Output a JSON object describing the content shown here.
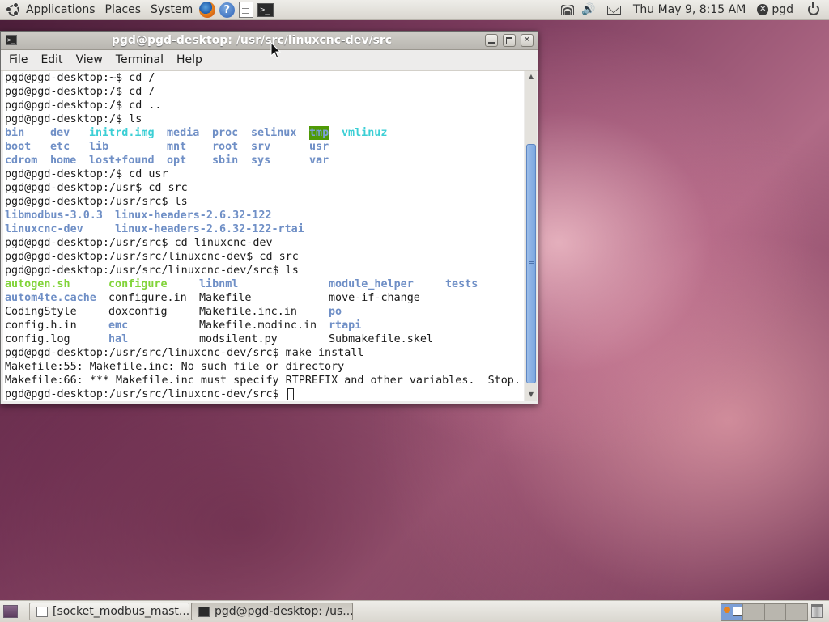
{
  "top_panel": {
    "menus": [
      "Applications",
      "Places",
      "System"
    ],
    "clock": "Thu May  9,  8:15 AM",
    "user": "pgd"
  },
  "terminal_window": {
    "title": "pgd@pgd-desktop: /usr/src/linuxcnc-dev/src",
    "menu": [
      "File",
      "Edit",
      "View",
      "Terminal",
      "Help"
    ],
    "lines": [
      "pgd@pgd-desktop:~$ cd /",
      "pgd@pgd-desktop:/$ cd /",
      "pgd@pgd-desktop:/$ cd ..",
      "pgd@pgd-desktop:/$ ls",
      "pgd@pgd-desktop:/$ cd usr",
      "pgd@pgd-desktop:/usr$ cd src",
      "pgd@pgd-desktop:/usr/src$ ls",
      "pgd@pgd-desktop:/usr/src$ cd linuxcnc-dev",
      "pgd@pgd-desktop:/usr/src/linuxcnc-dev$ cd src",
      "pgd@pgd-desktop:/usr/src/linuxcnc-dev/src$ ls",
      "pgd@pgd-desktop:/usr/src/linuxcnc-dev/src$ make install",
      "Makefile:55: Makefile.inc: No such file or directory",
      "Makefile:66: *** Makefile.inc must specify RTPREFIX and other variables.  Stop.",
      "pgd@pgd-desktop:/usr/src/linuxcnc-dev/src$ "
    ],
    "ls_root": [
      {
        "text": "bin",
        "type": "dir"
      },
      {
        "text": "dev",
        "type": "dir"
      },
      {
        "text": "initrd.img",
        "type": "link"
      },
      {
        "text": "media",
        "type": "dir"
      },
      {
        "text": "proc",
        "type": "dir"
      },
      {
        "text": "selinux",
        "type": "dir"
      },
      {
        "text": "tmp",
        "type": "tmp"
      },
      {
        "text": "vmlinuz",
        "type": "link"
      },
      {
        "text": "boot",
        "type": "dir"
      },
      {
        "text": "etc",
        "type": "dir"
      },
      {
        "text": "lib",
        "type": "dir"
      },
      {
        "text": "mnt",
        "type": "dir"
      },
      {
        "text": "root",
        "type": "dir"
      },
      {
        "text": "srv",
        "type": "dir"
      },
      {
        "text": "usr",
        "type": "dir"
      },
      {
        "text": "cdrom",
        "type": "dir"
      },
      {
        "text": "home",
        "type": "dir"
      },
      {
        "text": "lost+found",
        "type": "dir"
      },
      {
        "text": "opt",
        "type": "dir"
      },
      {
        "text": "sbin",
        "type": "dir"
      },
      {
        "text": "sys",
        "type": "dir"
      },
      {
        "text": "var",
        "type": "dir"
      }
    ],
    "ls_usr_src": [
      {
        "text": "libmodbus-3.0.3",
        "type": "dir"
      },
      {
        "text": "linux-headers-2.6.32-122",
        "type": "dir"
      },
      {
        "text": "linuxcnc-dev",
        "type": "dir"
      },
      {
        "text": "linux-headers-2.6.32-122-rtai",
        "type": "dir"
      }
    ],
    "ls_linuxcnc_src": [
      {
        "text": "autogen.sh",
        "type": "exe"
      },
      {
        "text": "configure",
        "type": "exe"
      },
      {
        "text": "libnml",
        "type": "dir"
      },
      {
        "text": "module_helper",
        "type": "dir"
      },
      {
        "text": "tests",
        "type": "dir"
      },
      {
        "text": "autom4te.cache",
        "type": "dir"
      },
      {
        "text": "configure.in",
        "type": "file"
      },
      {
        "text": "Makefile",
        "type": "file"
      },
      {
        "text": "move-if-change",
        "type": "file"
      },
      {
        "text": "CodingStyle",
        "type": "file"
      },
      {
        "text": "doxconfig",
        "type": "file"
      },
      {
        "text": "Makefile.inc.in",
        "type": "file"
      },
      {
        "text": "po",
        "type": "dir"
      },
      {
        "text": "config.h.in",
        "type": "file"
      },
      {
        "text": "emc",
        "type": "dir"
      },
      {
        "text": "Makefile.modinc.in",
        "type": "file"
      },
      {
        "text": "rtapi",
        "type": "dir"
      },
      {
        "text": "config.log",
        "type": "file"
      },
      {
        "text": "hal",
        "type": "dir"
      },
      {
        "text": "modsilent.py",
        "type": "file"
      },
      {
        "text": "Submakefile.skel",
        "type": "file"
      }
    ]
  },
  "bottom_panel": {
    "tasks": [
      "[socket_modbus_mast...",
      "pgd@pgd-desktop: /us..."
    ]
  },
  "colors": {
    "dir": "#6f8fc6",
    "link": "#3ccfd5",
    "exe": "#82d43a",
    "tmp_bg": "#4f9a06"
  }
}
